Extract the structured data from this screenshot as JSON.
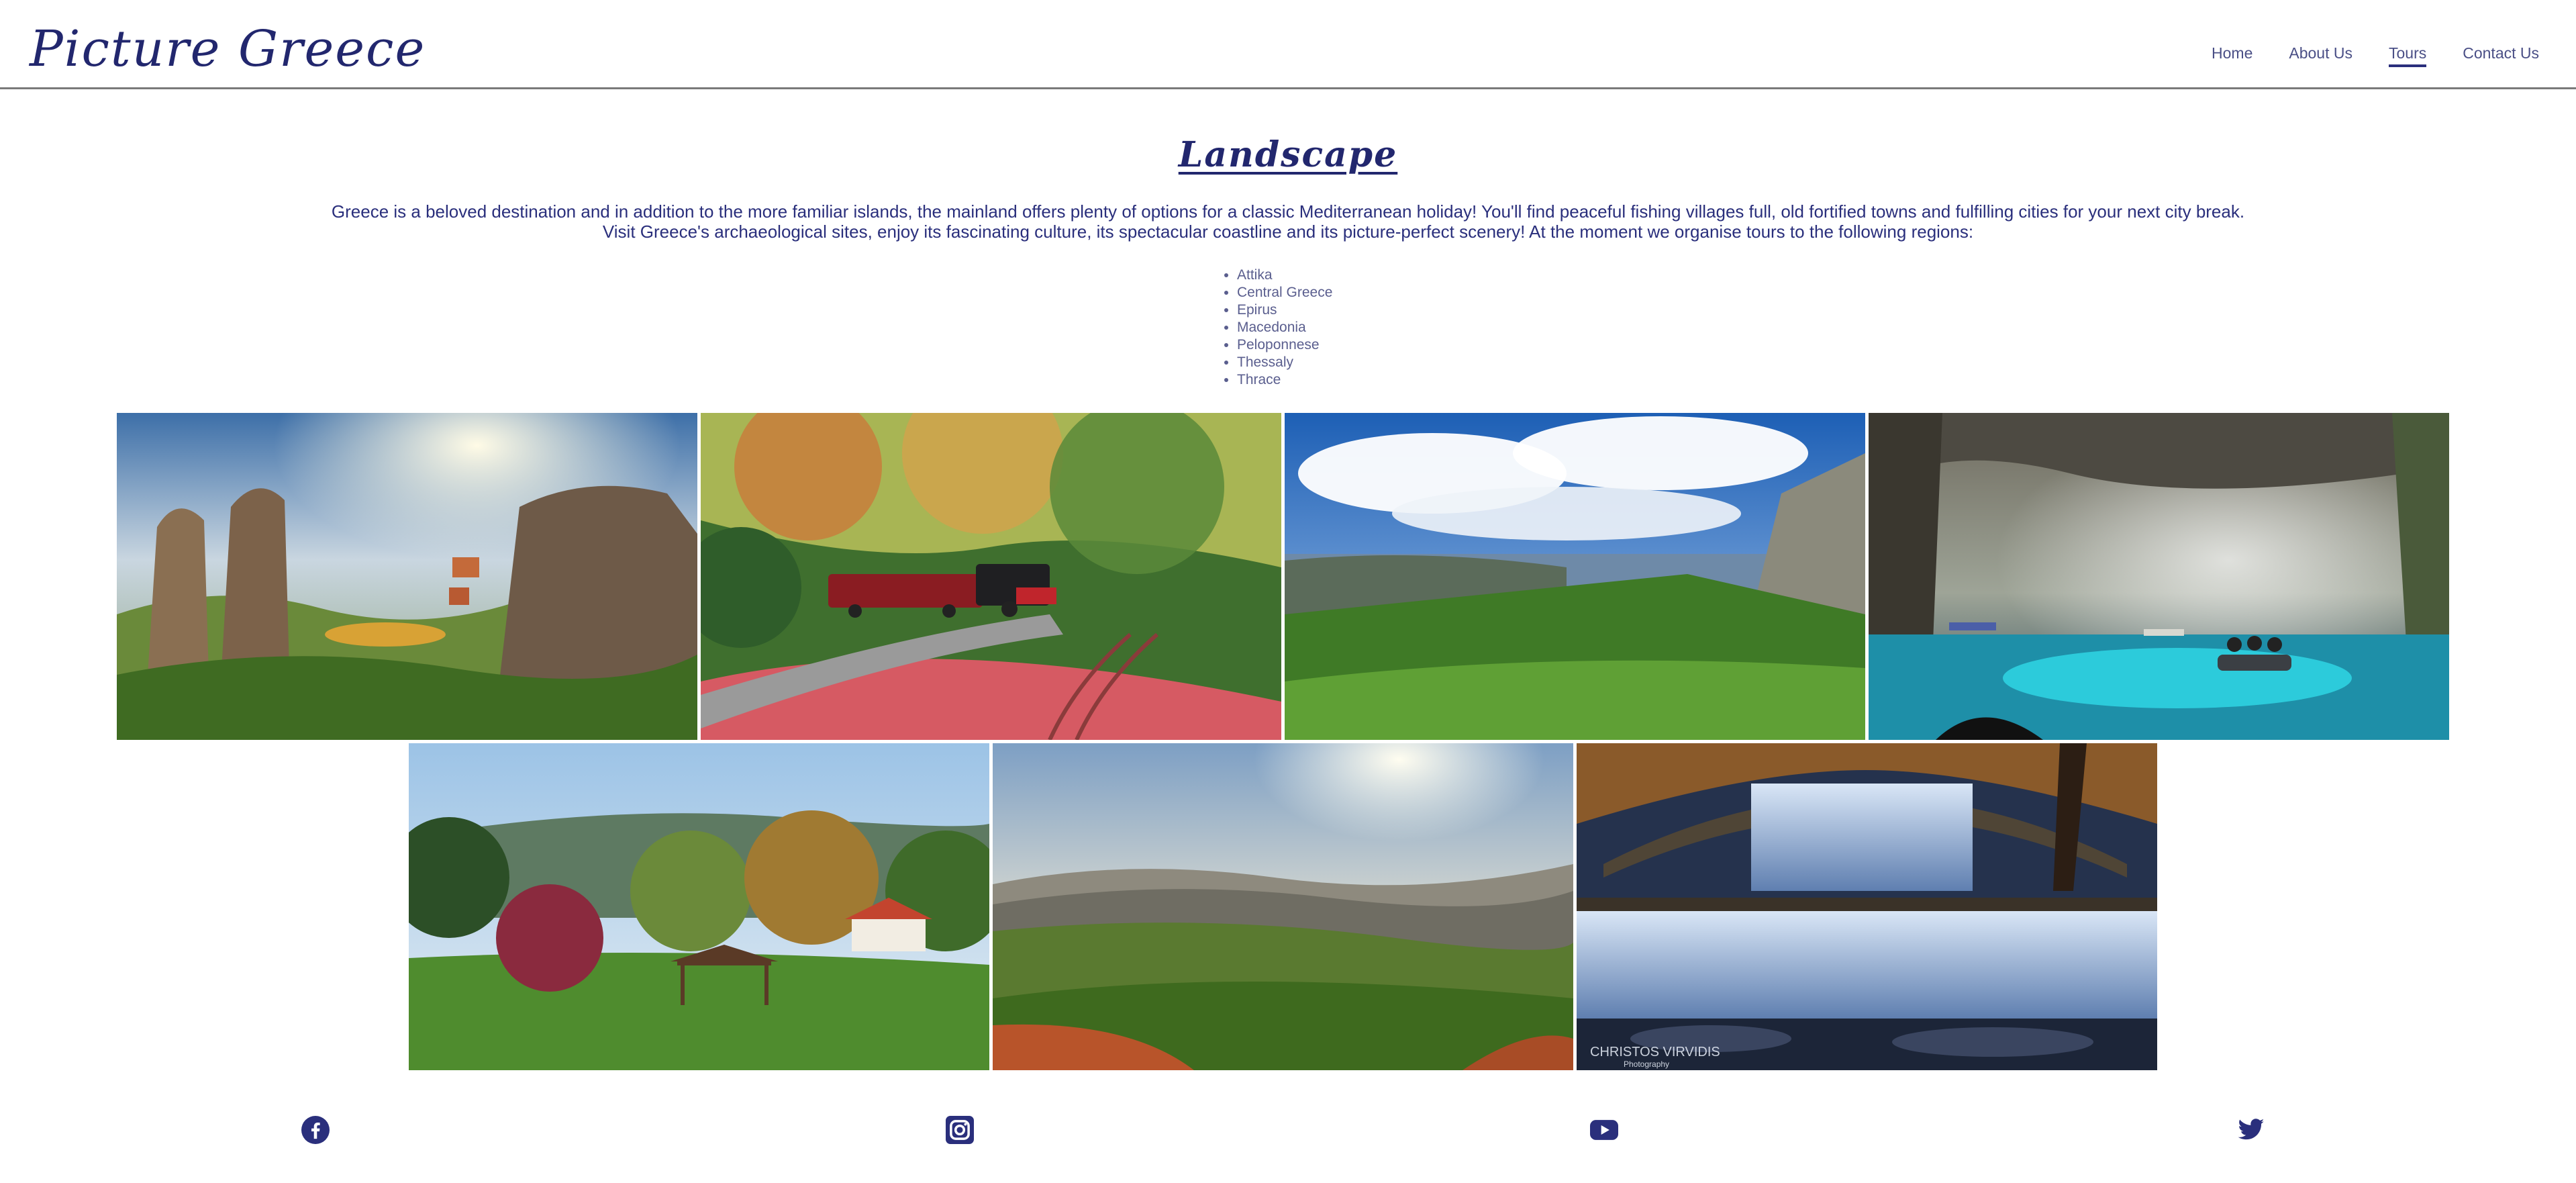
{
  "header": {
    "brand": "Picture Greece",
    "nav": [
      {
        "label": "Home",
        "active": false
      },
      {
        "label": "About Us",
        "active": false
      },
      {
        "label": "Tours",
        "active": true
      },
      {
        "label": "Contact Us",
        "active": false
      }
    ]
  },
  "main": {
    "title": "Landscape",
    "intro": "Greece is a beloved destination and in addition to the more familiar islands, the mainland offers plenty of options for a classic Mediterranean holiday! You'll find peaceful fishing villages full, old fortified towns and fulfilling cities for your next city break. Visit Greece's archaeological sites, enjoy its fascinating culture, its spectacular coastline and its picture-perfect scenery! At the moment we organise tours to the following regions:",
    "regions": [
      "Attika",
      "Central Greece",
      "Epirus",
      "Macedonia",
      "Peloponnese",
      "Thessaly",
      "Thrace"
    ]
  },
  "gallery": {
    "photos": [
      {
        "subject": "meteora-rocks-sunrays"
      },
      {
        "subject": "red-train-autumn-forest"
      },
      {
        "subject": "green-mountain-lake-view"
      },
      {
        "subject": "cave-lake-boat"
      },
      {
        "subject": "park-trees-gazebo"
      },
      {
        "subject": "mountain-valley-haze"
      },
      {
        "subject": "waterfall-stone-bridge"
      }
    ],
    "watermark": "CHRISTOS VIRVIDIS\nPhotography"
  },
  "footer": {
    "social": [
      "facebook-icon",
      "instagram-icon",
      "youtube-icon",
      "twitter-icon"
    ]
  },
  "colors": {
    "brand": "#22276e",
    "text": "#2a2f7c",
    "nav": "#4a4f86",
    "divider": "#7a7a7a"
  }
}
